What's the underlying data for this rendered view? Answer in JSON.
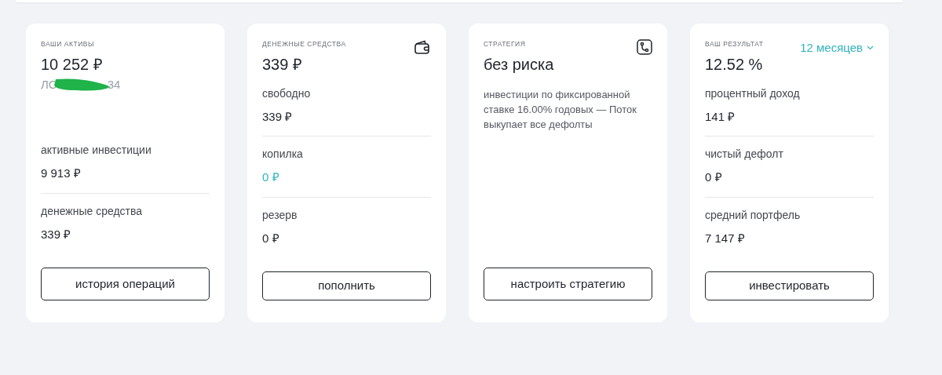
{
  "cards": [
    {
      "kind": "assets",
      "label": "ВАШИ АКТИВЫ",
      "headline": "10 252 ₽",
      "account": {
        "prefix": "ЛС",
        "suffix": "34",
        "redacted": true
      },
      "stats": [
        {
          "label": "активные инвестиции",
          "value": "9 913 ₽",
          "accent": false
        },
        {
          "label": "денежные средства",
          "value": "339 ₽",
          "accent": false
        }
      ],
      "button": "история операций"
    },
    {
      "kind": "cash",
      "label": "ДЕНЕЖНЫЕ СРЕДСТВА",
      "headline": "339 ₽",
      "stats": [
        {
          "label": "свободно",
          "value": "339 ₽",
          "accent": false
        },
        {
          "label": "копилка",
          "value": "0 ₽",
          "accent": true
        },
        {
          "label": "резерв",
          "value": "0 ₽",
          "accent": false
        }
      ],
      "button": "пополнить"
    },
    {
      "kind": "strategy",
      "label": "СТРАТЕГИЯ",
      "headline": "без риска",
      "description": "инвестиции по фиксированной ставке 16.00% годовых — Поток выкупает все дефолты",
      "button": "настроить стратегию"
    },
    {
      "kind": "result",
      "label": "ВАШ РЕЗУЛЬТАТ",
      "period": "12 месяцев",
      "headline": "12.52 %",
      "stats": [
        {
          "label": "процентный доход",
          "value": "141 ₽",
          "accent": false
        },
        {
          "label": "чистый дефолт",
          "value": "0 ₽",
          "accent": false
        },
        {
          "label": "средний портфель",
          "value": "7 147 ₽",
          "accent": false
        }
      ],
      "button": "инвестировать"
    }
  ]
}
